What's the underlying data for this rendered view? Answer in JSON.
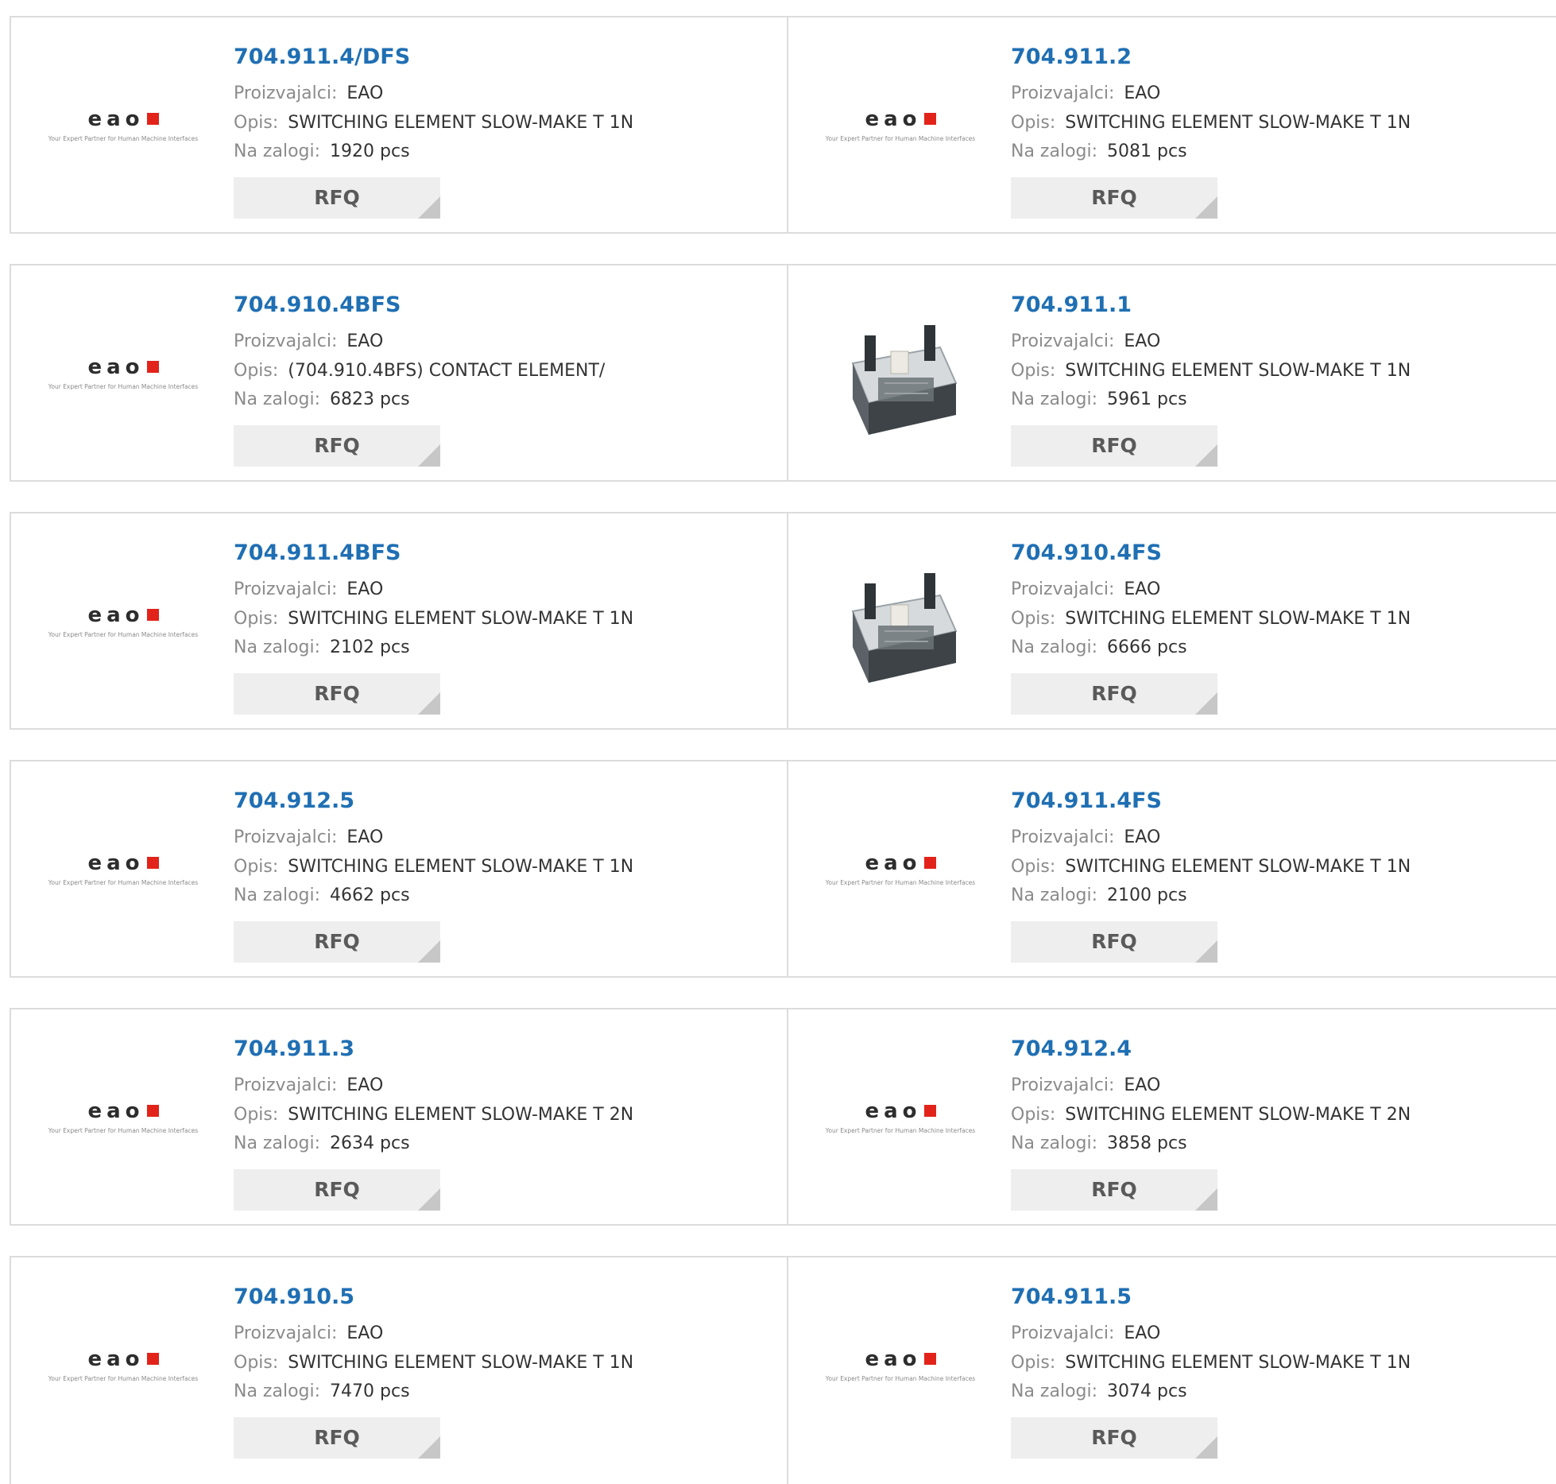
{
  "labels": {
    "manufacturer": "Proizvajalci:",
    "description": "Opis:",
    "stock": "Na zalogi:",
    "rfq": "RFQ"
  },
  "logo": {
    "word": "eao",
    "tagline": "Your Expert Partner for Human Machine Interfaces"
  },
  "colors": {
    "title": "#1f6fb3",
    "label": "#8b8b8b",
    "logo_square": "#e2231a",
    "rfq_bg": "#eeeeee"
  },
  "rows": [
    [
      {
        "part": "704.911.4/DFS",
        "manufacturer": "EAO",
        "description": "SWITCHING ELEMENT SLOW-MAKE T 1N",
        "stock": "1920 pcs",
        "image": "eao-logo"
      },
      {
        "part": "704.911.2",
        "manufacturer": "EAO",
        "description": "SWITCHING ELEMENT SLOW-MAKE T 1N",
        "stock": "5081 pcs",
        "image": "eao-logo"
      }
    ],
    [
      {
        "part": "704.910.4BFS",
        "manufacturer": "EAO",
        "description": "(704.910.4BFS) CONTACT ELEMENT/",
        "stock": "6823 pcs",
        "image": "eao-logo"
      },
      {
        "part": "704.911.1",
        "manufacturer": "EAO",
        "description": "SWITCHING ELEMENT SLOW-MAKE T 1N",
        "stock": "5961 pcs",
        "image": "product-photo"
      }
    ],
    [
      {
        "part": "704.911.4BFS",
        "manufacturer": "EAO",
        "description": "SWITCHING ELEMENT SLOW-MAKE T 1N",
        "stock": "2102 pcs",
        "image": "eao-logo"
      },
      {
        "part": "704.910.4FS",
        "manufacturer": "EAO",
        "description": "SWITCHING ELEMENT SLOW-MAKE T 1N",
        "stock": "6666 pcs",
        "image": "product-photo"
      }
    ],
    [
      {
        "part": "704.912.5",
        "manufacturer": "EAO",
        "description": "SWITCHING ELEMENT SLOW-MAKE T 1N",
        "stock": "4662 pcs",
        "image": "eao-logo"
      },
      {
        "part": "704.911.4FS",
        "manufacturer": "EAO",
        "description": "SWITCHING ELEMENT SLOW-MAKE T 1N",
        "stock": "2100 pcs",
        "image": "eao-logo"
      }
    ],
    [
      {
        "part": "704.911.3",
        "manufacturer": "EAO",
        "description": "SWITCHING ELEMENT SLOW-MAKE T 2N",
        "stock": "2634 pcs",
        "image": "eao-logo"
      },
      {
        "part": "704.912.4",
        "manufacturer": "EAO",
        "description": "SWITCHING ELEMENT SLOW-MAKE T 2N",
        "stock": "3858 pcs",
        "image": "eao-logo"
      }
    ],
    [
      {
        "part": "704.910.5",
        "manufacturer": "EAO",
        "description": "SWITCHING ELEMENT SLOW-MAKE T 1N",
        "stock": "7470 pcs",
        "image": "eao-logo"
      },
      {
        "part": "704.911.5",
        "manufacturer": "EAO",
        "description": "SWITCHING ELEMENT SLOW-MAKE T 1N",
        "stock": "3074 pcs",
        "image": "eao-logo"
      }
    ]
  ]
}
